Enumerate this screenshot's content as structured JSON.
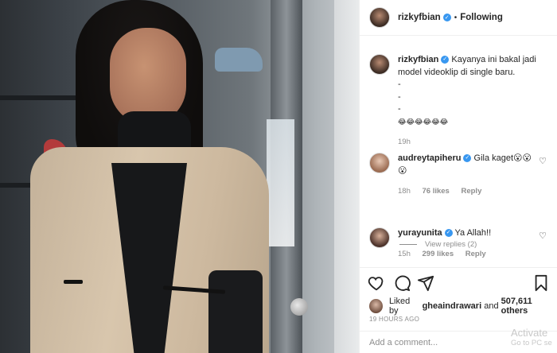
{
  "post": {
    "username": "rizkyfbian",
    "follow_status": "Following",
    "caption": {
      "username": "rizkyfbian",
      "line1": "Kayanya ini bakal jadi",
      "line2": "model videoklip di single baru.",
      "dash1": "-",
      "dash2": "-",
      "dash3": "-",
      "emojis": "😂😂😂😂😂😂",
      "time": "19h"
    },
    "comments": [
      {
        "username": "audreytapiheru",
        "text": "Gila kaget😮😮",
        "text2": "😮",
        "time": "18h",
        "likes": "76 likes",
        "reply": "Reply"
      },
      {
        "username": "yurayunita",
        "text": "Ya Allah!!",
        "time": "15h",
        "likes": "299 likes",
        "reply": "Reply"
      }
    ],
    "view_replies": "View replies (2)",
    "liked_by_prefix": "Liked by",
    "liked_by_user": "gheaindrawari",
    "liked_by_and": "and",
    "liked_by_count": "507,611 others",
    "timestamp": "19 HOURS AGO",
    "add_comment_placeholder": "Add a comment..."
  },
  "watermark": {
    "line1": "Activate",
    "line2": "Go to PC se"
  },
  "icons": [
    "heart-icon",
    "comment-icon",
    "share-icon",
    "bookmark-icon",
    "verified-icon",
    "like-comment-icon"
  ]
}
